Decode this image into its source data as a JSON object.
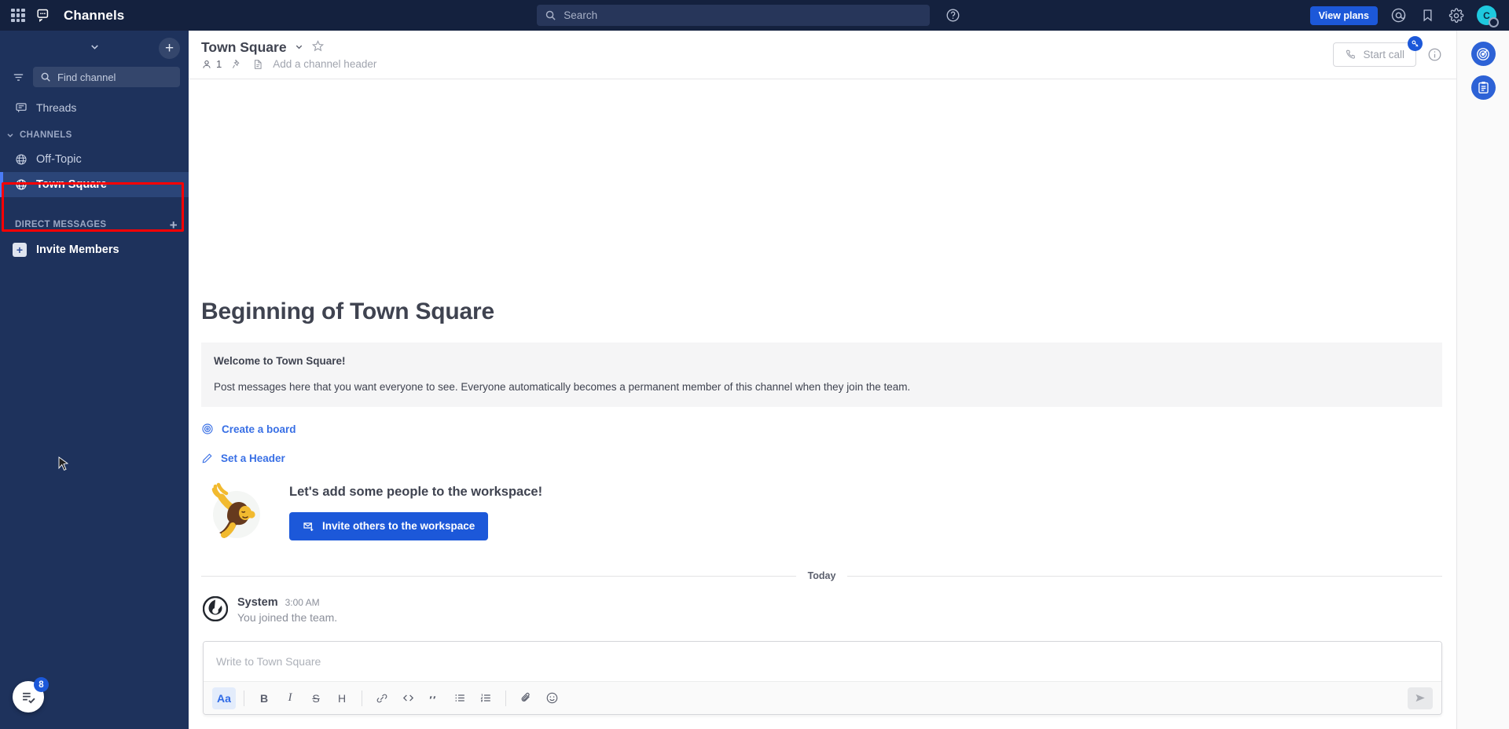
{
  "global_header": {
    "product_name": "Channels",
    "grid_icon": "apps-grid-icon",
    "product_icon": "channels-icon",
    "search": {
      "placeholder": "Search",
      "icon": "search-icon"
    },
    "help_icon": "help-circle-icon",
    "view_plans_label": "View plans",
    "mentions_icon": "at-mention-icon",
    "saved_icon": "bookmark-icon",
    "settings_icon": "gear-icon",
    "avatar_initial": "C",
    "avatar_status": "offline"
  },
  "sidebar": {
    "team_chevron_icon": "chevron-down-icon",
    "browse_add_icon": "plus-icon",
    "filter_icon": "filter-icon",
    "find_channel": {
      "placeholder": "Find channel",
      "icon": "search-icon"
    },
    "threads": {
      "label": "Threads",
      "icon": "threads-icon"
    },
    "categories": [
      {
        "name": "CHANNELS",
        "chevron_icon": "chevron-down-icon",
        "channels": [
          {
            "label": "Off-Topic",
            "icon": "globe-icon",
            "active": false
          },
          {
            "label": "Town Square",
            "icon": "globe-icon",
            "active": true
          }
        ]
      },
      {
        "name": "DIRECT MESSAGES",
        "plus_icon": "plus-icon",
        "channels": []
      }
    ],
    "invite_members": {
      "label": "Invite Members",
      "icon": "plus-box-icon"
    },
    "onboarding_fab": {
      "icon": "checklist-icon",
      "badge": "8"
    },
    "highlight_color": "#ff0000"
  },
  "channel_header": {
    "name": "Town Square",
    "chevron_icon": "chevron-down-icon",
    "favorite_icon": "star-outline-icon",
    "member_count": "1",
    "member_icon": "member-icon",
    "pin_icon": "pin-icon",
    "files_icon": "file-icon",
    "add_header_label": "Add a channel header",
    "start_call_label": "Start call",
    "start_call_icon": "phone-icon",
    "start_call_badge_icon": "key-icon",
    "info_icon": "info-circle-icon"
  },
  "channel_intro": {
    "beginning_title": "Beginning of Town Square",
    "welcome_title": "Welcome to Town Square!",
    "welcome_body": "Post messages here that you want everyone to see. Everyone automatically becomes a permanent member of this channel when they join the team.",
    "actions": [
      {
        "label": "Create a board",
        "icon": "board-target-icon"
      },
      {
        "label": "Set a Header",
        "icon": "pencil-icon"
      }
    ],
    "invite_prompt": "Let's add some people to the workspace!",
    "invite_button_label": "Invite others to the workspace",
    "invite_button_icon": "envelope-plus-icon",
    "illustration": "person-waving-illustration"
  },
  "messages": {
    "date_divider": "Today",
    "posts": [
      {
        "author": "System",
        "timestamp": "3:00 AM",
        "text": "You joined the team.",
        "avatar_icon": "mattermost-logo-icon"
      }
    ]
  },
  "composer": {
    "placeholder": "Write to Town Square",
    "toolbar": [
      {
        "name": "formatting-toggle",
        "glyph": "Aa",
        "active": true
      },
      {
        "name": "bold",
        "glyph": "B",
        "active": false
      },
      {
        "name": "italic",
        "glyph": "I",
        "active": false
      },
      {
        "name": "strikethrough",
        "glyph": "S",
        "active": false
      },
      {
        "name": "heading",
        "glyph": "H",
        "active": false
      },
      {
        "name": "link",
        "glyph": "link-icon",
        "active": false
      },
      {
        "name": "code",
        "glyph": "code-icon",
        "active": false
      },
      {
        "name": "quote",
        "glyph": "quote-icon",
        "active": false
      },
      {
        "name": "bulleted-list",
        "glyph": "bullet-list-icon",
        "active": false
      },
      {
        "name": "numbered-list",
        "glyph": "numbered-list-icon",
        "active": false
      },
      {
        "name": "attachment",
        "glyph": "paperclip-icon",
        "active": false
      },
      {
        "name": "emoji",
        "glyph": "emoji-icon",
        "active": false
      }
    ],
    "send_icon": "send-icon"
  },
  "app_bar": {
    "items": [
      {
        "name": "playbooks",
        "icon": "target-icon"
      },
      {
        "name": "boards",
        "icon": "clipboard-icon"
      }
    ]
  },
  "colors": {
    "brand_blue": "#1c58d9",
    "sidebar_bg": "#1e325c",
    "header_bg": "#14213e",
    "active_channel_bg": "#2b4578",
    "link_blue": "#386fe5"
  }
}
